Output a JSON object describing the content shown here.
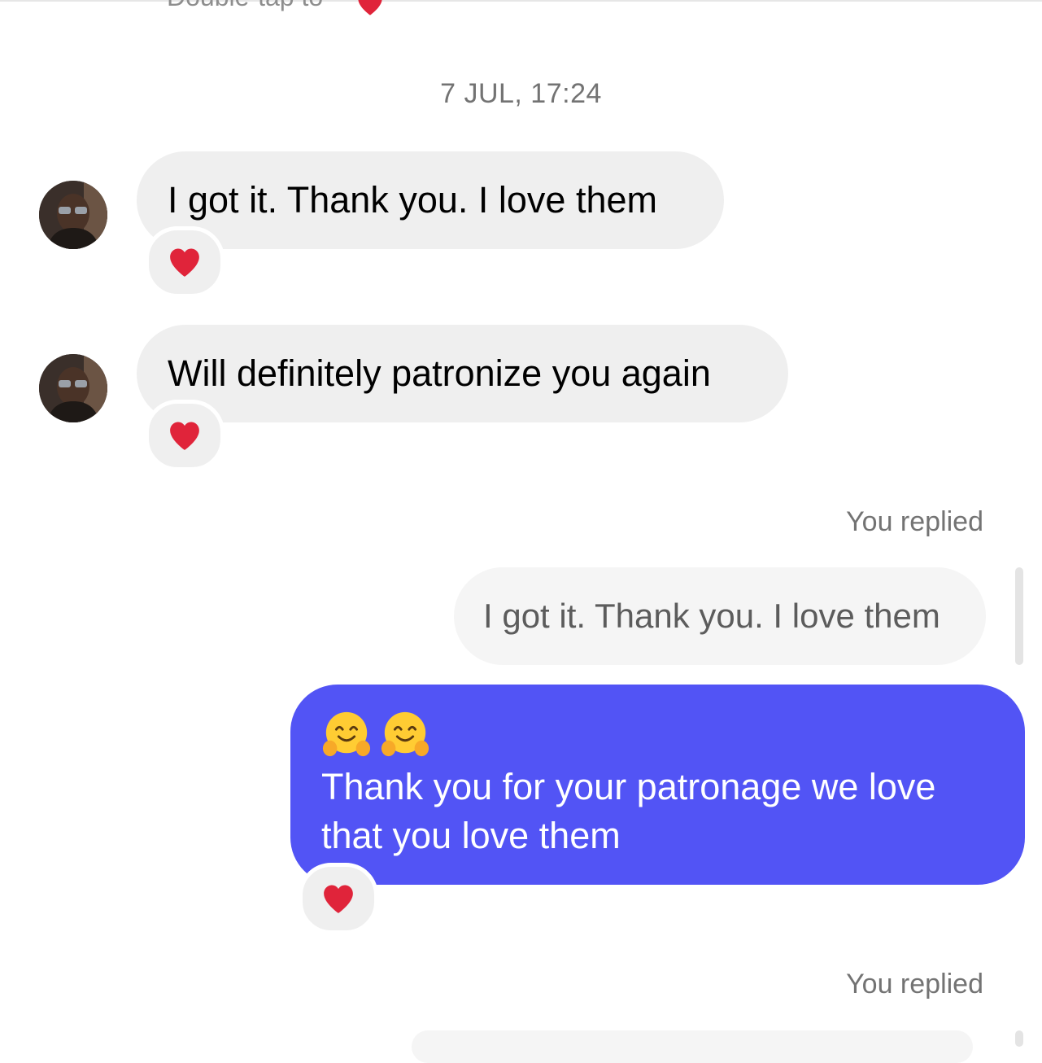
{
  "thread": {
    "top_hint": "Double-tap to",
    "timestamp": "7 JUL, 17:24"
  },
  "incoming_messages": [
    {
      "text": "I got it. Thank you. I love them",
      "reaction": "red-heart"
    },
    {
      "text": "Will definitely patronize you again",
      "reaction": "red-heart"
    }
  ],
  "outgoing_reply": {
    "label": "You replied",
    "quoted_text": "I got it. Thank you. I love them",
    "emojis": [
      "hugging-face",
      "hugging-face"
    ],
    "text": "Thank you for your patronage we love that you love them",
    "reaction": "red-heart",
    "bubble_color": "#5254f5"
  },
  "next_reply": {
    "label": "You replied"
  },
  "colors": {
    "incoming_bubble": "#efefef",
    "quoted_bubble": "#f5f5f5",
    "meta_text": "#737373",
    "heart": "#e0243a"
  }
}
